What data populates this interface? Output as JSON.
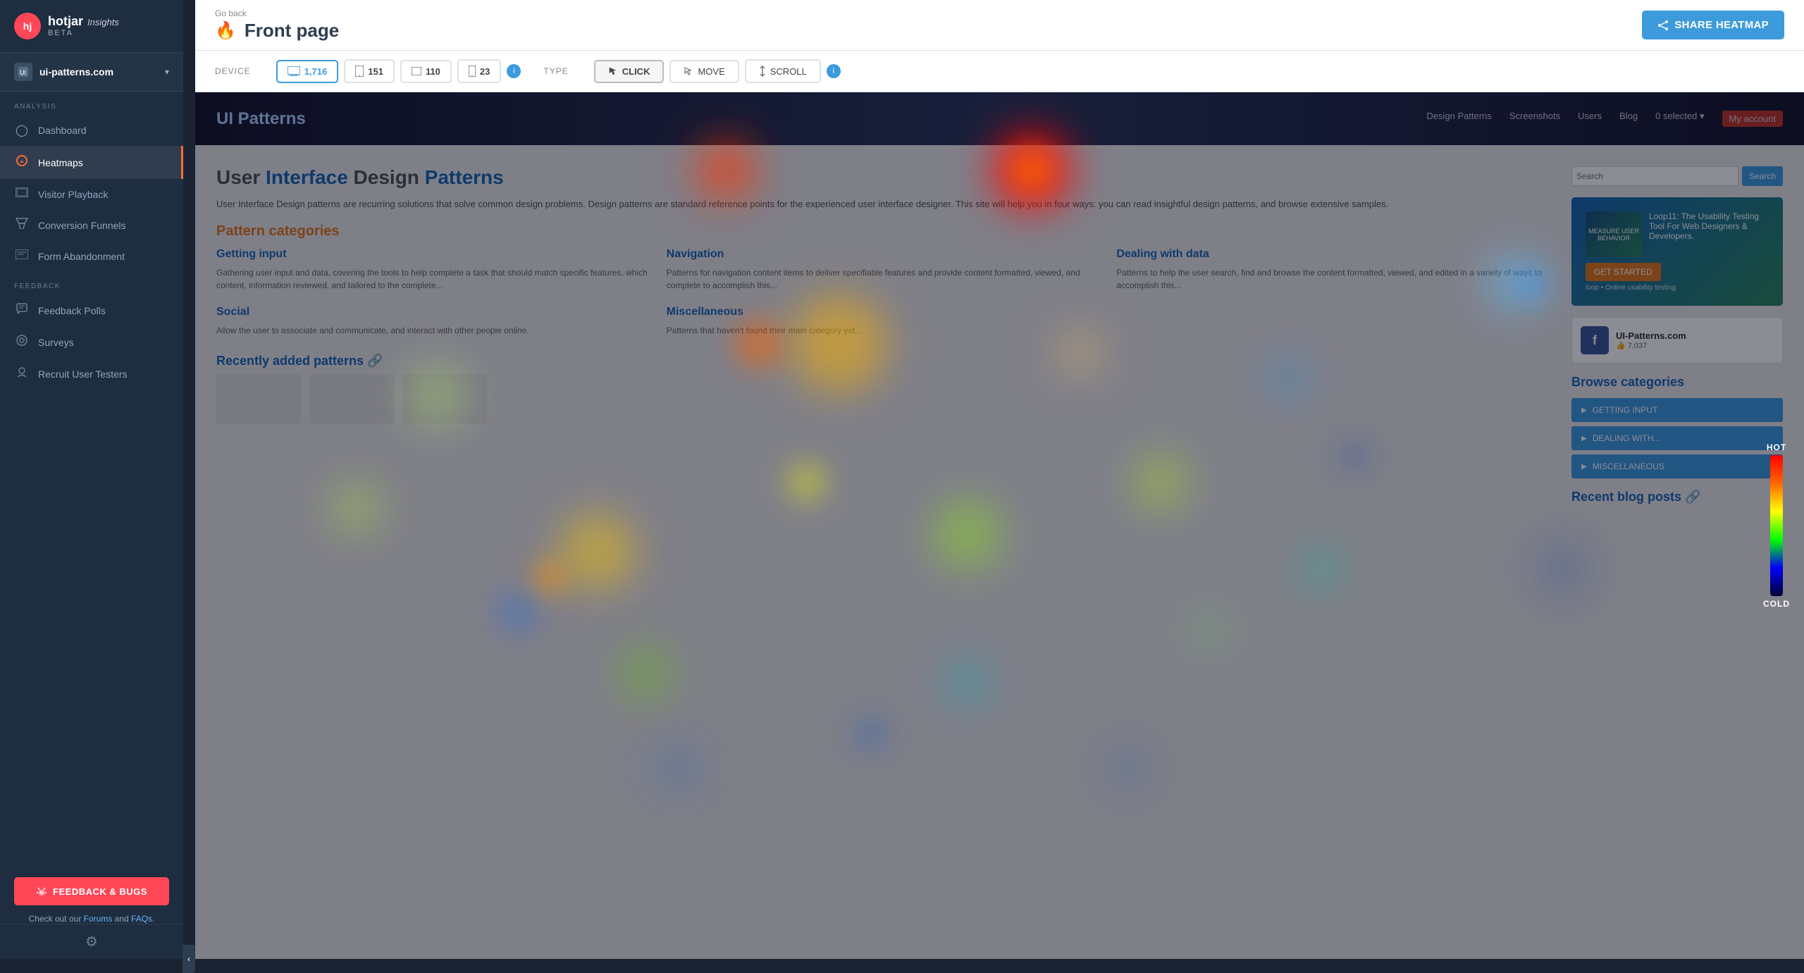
{
  "app": {
    "logo_text": "hotjar",
    "logo_sub": "Insights",
    "logo_badge": "BETA"
  },
  "site_selector": {
    "icon": "🌐",
    "name": "ui-patterns.com",
    "chevron": "▾"
  },
  "sidebar": {
    "collapse_icon": "‹",
    "analysis_label": "ANALYSIS",
    "feedback_label": "FEEDBACK",
    "nav_items": [
      {
        "id": "dashboard",
        "label": "Dashboard",
        "icon": "◯",
        "active": false
      },
      {
        "id": "heatmaps",
        "label": "Heatmaps",
        "icon": "🔥",
        "active": true
      },
      {
        "id": "visitor-playback",
        "label": "Visitor Playback",
        "icon": "▱",
        "active": false
      },
      {
        "id": "conversion-funnels",
        "label": "Conversion Funnels",
        "icon": "⋏",
        "active": false
      },
      {
        "id": "form-abandonment",
        "label": "Form Abandonment",
        "icon": "▭",
        "active": false
      },
      {
        "id": "feedback-polls",
        "label": "Feedback Polls",
        "icon": "▦",
        "active": false
      },
      {
        "id": "surveys",
        "label": "Surveys",
        "icon": "◈",
        "active": false
      },
      {
        "id": "recruit-user-testers",
        "label": "Recruit User Testers",
        "icon": "◎",
        "active": false
      }
    ],
    "feedback_bugs_btn": "FEEDBACK & BUGS",
    "footer_text": "Check out our ",
    "footer_forums": "Forums",
    "footer_and": " and ",
    "footer_faqs": "FAQs",
    "footer_dot": ".",
    "settings_icon": "⚙"
  },
  "topbar": {
    "go_back": "Go back",
    "flame_icon": "🔥",
    "page_title": "Front page",
    "share_btn": "SHARE HEATMAP",
    "share_icon": "↗"
  },
  "controls": {
    "device_label": "DEVICE",
    "type_label": "TYPE",
    "devices": [
      {
        "id": "desktop",
        "icon": "🖥",
        "count": "1,716",
        "active": true
      },
      {
        "id": "tablet",
        "icon": "⬜",
        "count": "151",
        "active": false
      },
      {
        "id": "tablet-sm",
        "icon": "▭",
        "count": "110",
        "active": false
      },
      {
        "id": "mobile",
        "icon": "📱",
        "count": "23",
        "active": false
      }
    ],
    "types": [
      {
        "id": "click",
        "icon": "↖",
        "label": "CLICK",
        "active": true
      },
      {
        "id": "move",
        "icon": "↖",
        "label": "MOVE",
        "active": false
      },
      {
        "id": "scroll",
        "icon": "↕",
        "label": "SCROLL",
        "active": false
      }
    ]
  },
  "heatmap_scale": {
    "hot_label": "HOT",
    "cold_label": "COLD"
  },
  "site": {
    "header": {
      "logo": "UI Patterns",
      "nav": [
        "Design Patterns",
        "Screenshots",
        "Users",
        "Blog",
        "0 selected ▾",
        "My account"
      ]
    },
    "main": {
      "title": "User Interface Design Patterns",
      "intro": "User Interface Design patterns are recurring solutions that solve common design problems. Design patterns are standard reference points for the experienced user interface designer. This site will help you in four ways: you can read insightful design patterns, and browse extensive samples.",
      "categories_title": "Pattern categories",
      "cards": [
        {
          "title": "Getting input",
          "desc": "Gathering user input and data, covering the tools to help complete a task that should match specific features, which content, information reviewed, and tailored to..."
        },
        {
          "title": "Navigation",
          "desc": "Patterns for navigation content items to deliver specifiable features and provide content formatted, viewed, and complete to..."
        },
        {
          "title": "Dealing with data",
          "desc": "Patterns to help the user search, find and browse the content formatted, viewed, and edited in a variety of ways to accomplish this..."
        }
      ],
      "cards2": [
        {
          "title": "Social",
          "desc": "Allow the user to associate and communicate, and interact with other people online."
        },
        {
          "title": "Miscellaneous",
          "desc": "Patterns that haven't found their main category yet..."
        }
      ],
      "recently_title": "Recently added patterns 🔗"
    },
    "sidebar": {
      "search_placeholder": "Search",
      "search_btn": "Search",
      "ad_title": "MEASURE USER BEHAVIOR",
      "ad_subtitle": "Loop11: The Usability Testing Tool For Web Designers & Developers.",
      "ad_btn": "GET STARTED",
      "fb_name": "UI-Patterns.com",
      "fb_likes": "7,037",
      "browse_title": "Browse categories",
      "browse_items": [
        "▶ GETTING INPUT",
        "▶ DEALING WITH...",
        "▶ MISCELLANEOUS"
      ],
      "recent_blog_title": "Recent blog posts 🔗"
    }
  }
}
